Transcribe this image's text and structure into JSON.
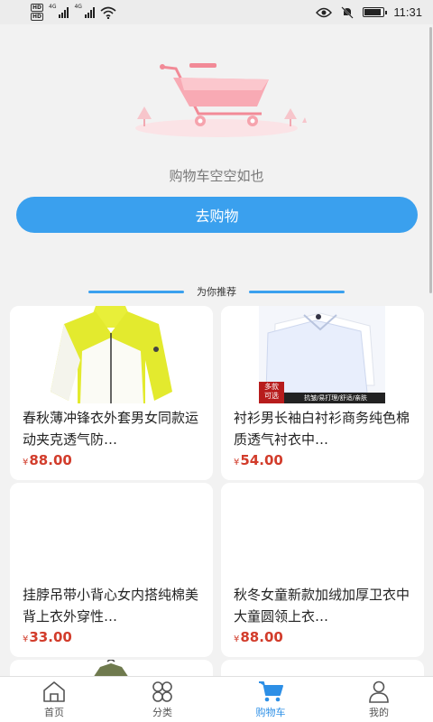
{
  "status_bar": {
    "hd1": "HD",
    "hd2": "HD",
    "net1": "4G",
    "net2": "4G",
    "time": "11:31",
    "battery_level": 0.9
  },
  "empty_cart": {
    "message": "购物车空空如也",
    "button_label": "去购物"
  },
  "recommend": {
    "title": "为你推荐"
  },
  "products": [
    {
      "title": "春秋薄冲锋衣外套男女同款运动夹克透气防…",
      "currency": "¥",
      "price": "88.00",
      "image_icon": "jacket-image"
    },
    {
      "title": "衬衫男长袖白衬衫商务纯色棉质透气衬衣中…",
      "currency": "¥",
      "price": "54.00",
      "image_icon": "shirt-image",
      "badge_main": "多款",
      "badge_sub": "可选",
      "badge_tags": "抗皱/易打理/舒适/亲肤"
    },
    {
      "title": "挂脖吊带小背心女内搭纯棉美背上衣外穿性…",
      "currency": "¥",
      "price": "33.00",
      "image_icon": "camisole-image"
    },
    {
      "title": "秋冬女童新款加绒加厚卫衣中大童圆领上衣…",
      "currency": "¥",
      "price": "88.00",
      "image_icon": "hoodie-image"
    }
  ],
  "tabs": [
    {
      "label": "首页",
      "icon": "home-icon",
      "active": false
    },
    {
      "label": "分类",
      "icon": "category-icon",
      "active": false
    },
    {
      "label": "购物车",
      "icon": "cart-icon",
      "active": true
    },
    {
      "label": "我的",
      "icon": "user-icon",
      "active": false
    }
  ],
  "colors": {
    "accent": "#3aa0ee",
    "price": "#d23c2b",
    "tab_active": "#2d8fe6",
    "background": "#f2f2f2"
  }
}
